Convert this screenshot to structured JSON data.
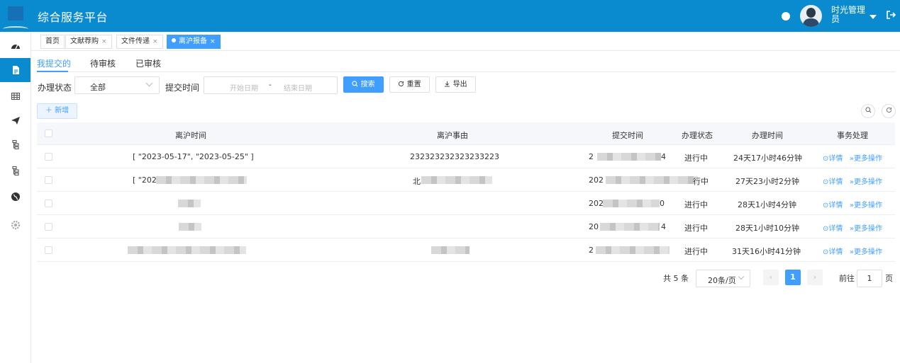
{
  "header": {
    "title": "综合服务平台",
    "user_name": "时光管理员"
  },
  "tabs": [
    {
      "label": "首页"
    },
    {
      "label": "文献荐购",
      "close": "×"
    },
    {
      "label": "文件传递",
      "close": "×"
    },
    {
      "label": "离沪报备",
      "close": "×"
    }
  ],
  "subtabs": [
    "我提交的",
    "待审核",
    "已审核"
  ],
  "filters": {
    "status_label": "办理状态",
    "status_value": "全部",
    "time_label": "提交时间",
    "start_placeholder": "开始日期",
    "separator": "-",
    "end_placeholder": "结束日期",
    "search": "搜索",
    "reset": "重置",
    "export": "导出",
    "add": "新增"
  },
  "table": {
    "columns": [
      "离沪时间",
      "离沪事由",
      "提交时间",
      "办理状态",
      "办理时间",
      "事务处理"
    ],
    "rows": [
      {
        "time": "[ \"2023-05-17\", \"2023-05-25\" ]",
        "reason": "232323232323233223",
        "submit_start": "2",
        "submit_end": "4",
        "status": "进行中",
        "duration": "24天17小时46分钟",
        "detail": "详情",
        "more": "更多操作"
      },
      {
        "time": "[ \"202",
        "reason": "北",
        "submit_start": "202",
        "submit_end": "",
        "status": "行中",
        "duration": "27天23小时2分钟",
        "detail": "详情",
        "more": "更多操作"
      },
      {
        "time": "",
        "reason": "",
        "submit_start": "202",
        "submit_end": "0",
        "status": "进行中",
        "duration": "28天1小时4分钟",
        "detail": "详情",
        "more": "更多操作"
      },
      {
        "time": "",
        "reason": "",
        "submit_start": "20",
        "submit_end": "4",
        "status": "进行中",
        "duration": "28天1小时10分钟",
        "detail": "详情",
        "more": "更多操作"
      },
      {
        "time": "",
        "reason": "",
        "submit_start": "2",
        "submit_end": "",
        "status": "进行中",
        "duration": "31天16小时41分钟",
        "detail": "详情",
        "more": "更多操作"
      }
    ]
  },
  "pagination": {
    "total": "共 5 条",
    "page_size": "20条/页",
    "current": "1",
    "prev": "‹",
    "next": "›",
    "goto": "前往",
    "goto_value": "1",
    "unit": "页"
  },
  "colors": {
    "header": "#0a8bd0",
    "accent": "#409eff"
  }
}
